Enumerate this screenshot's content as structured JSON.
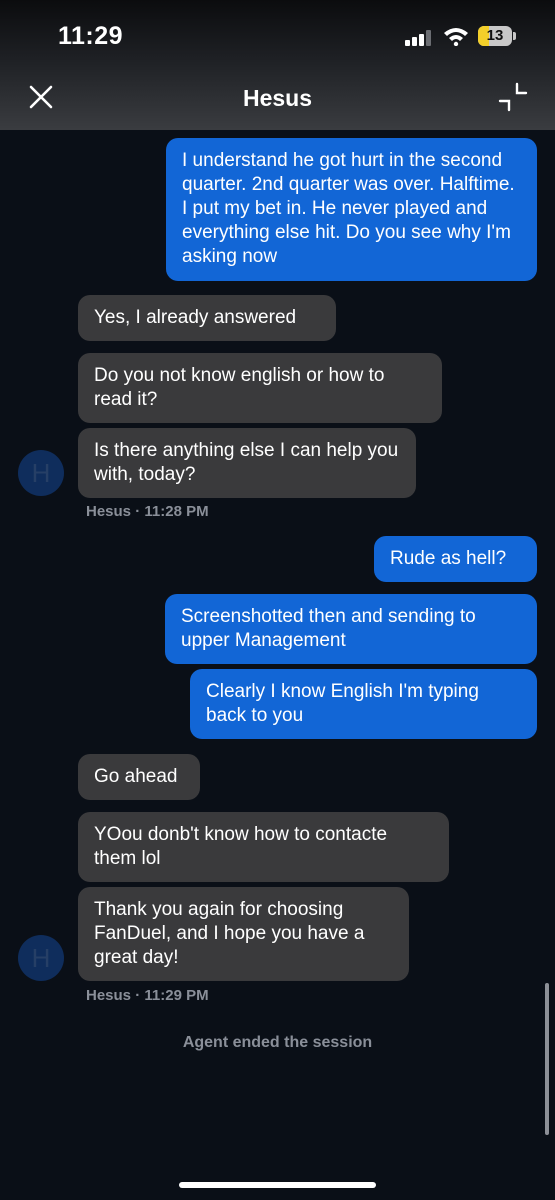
{
  "status_bar": {
    "time": "11:29",
    "battery_level": "13",
    "battery_color": "#f3cf2a"
  },
  "header": {
    "title": "Hesus",
    "close_icon": "close-icon",
    "minimize_icon": "minimize-icon"
  },
  "colors": {
    "user_bubble": "#1266d6",
    "agent_bubble": "#3a3a3c",
    "background": "#0a0f17",
    "avatar": "#0f2d5c"
  },
  "messages": [
    {
      "from": "user",
      "text": "I understand he got hurt in the second quarter. 2nd quarter was over. Halftime. I put my bet in. He never played and everything else hit. Do you see why I'm asking now"
    },
    {
      "from": "agent",
      "text": "Yes, I already answered"
    },
    {
      "from": "agent",
      "text": "Do you not know english or how to read it?"
    },
    {
      "from": "agent",
      "text": "Is there anything else I can help you with, today?"
    },
    {
      "from": "user",
      "text": "Rude as hell?"
    },
    {
      "from": "user",
      "text": "Screenshotted then and sending to upper Management"
    },
    {
      "from": "user",
      "text": "Clearly I know English I'm typing back to you"
    },
    {
      "from": "agent",
      "text": "Go ahead"
    },
    {
      "from": "agent",
      "text": "YOou donb't know how to contacte them lol"
    },
    {
      "from": "agent",
      "text": "Thank you again for choosing FanDuel, and I hope you have a great day!"
    }
  ],
  "avatars": [
    {
      "initial": "H"
    },
    {
      "initial": "H"
    }
  ],
  "meta": [
    {
      "sender": "Hesus",
      "time": "11:28 PM"
    },
    {
      "sender": "Hesus",
      "time": "11:29 PM"
    }
  ],
  "system_message": "Agent ended the session"
}
